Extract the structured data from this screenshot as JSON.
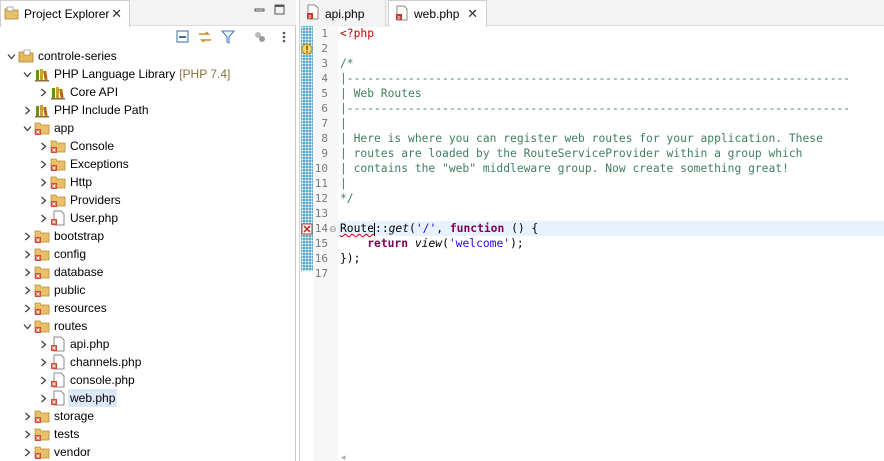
{
  "project_explorer": {
    "tab_title": "Project Explorer",
    "tree": [
      {
        "label": "controle-series",
        "level": 0,
        "expanded": true,
        "icon": "php-project-icon"
      },
      {
        "label": "PHP Language Library",
        "suffix": "[PHP 7.4]",
        "level": 1,
        "expanded": true,
        "icon": "library-icon"
      },
      {
        "label": "Core API",
        "level": 2,
        "expanded": false,
        "icon": "library-icon"
      },
      {
        "label": "PHP Include Path",
        "level": 1,
        "expanded": false,
        "icon": "library-icon"
      },
      {
        "label": "app",
        "level": 1,
        "expanded": true,
        "icon": "folder-icon"
      },
      {
        "label": "Console",
        "level": 2,
        "expanded": false,
        "icon": "folder-icon"
      },
      {
        "label": "Exceptions",
        "level": 2,
        "expanded": false,
        "icon": "folder-icon"
      },
      {
        "label": "Http",
        "level": 2,
        "expanded": false,
        "icon": "folder-icon"
      },
      {
        "label": "Providers",
        "level": 2,
        "expanded": false,
        "icon": "folder-icon"
      },
      {
        "label": "User.php",
        "level": 2,
        "expanded": false,
        "icon": "php-file-icon"
      },
      {
        "label": "bootstrap",
        "level": 1,
        "expanded": false,
        "icon": "folder-icon"
      },
      {
        "label": "config",
        "level": 1,
        "expanded": false,
        "icon": "folder-icon"
      },
      {
        "label": "database",
        "level": 1,
        "expanded": false,
        "icon": "folder-icon"
      },
      {
        "label": "public",
        "level": 1,
        "expanded": false,
        "icon": "folder-icon"
      },
      {
        "label": "resources",
        "level": 1,
        "expanded": false,
        "icon": "folder-icon"
      },
      {
        "label": "routes",
        "level": 1,
        "expanded": true,
        "icon": "folder-icon"
      },
      {
        "label": "api.php",
        "level": 2,
        "expanded": false,
        "icon": "php-file-icon"
      },
      {
        "label": "channels.php",
        "level": 2,
        "expanded": false,
        "icon": "php-file-icon"
      },
      {
        "label": "console.php",
        "level": 2,
        "expanded": false,
        "icon": "php-file-icon"
      },
      {
        "label": "web.php",
        "level": 2,
        "expanded": false,
        "icon": "php-file-icon",
        "selected": true
      },
      {
        "label": "storage",
        "level": 1,
        "expanded": false,
        "icon": "folder-icon"
      },
      {
        "label": "tests",
        "level": 1,
        "expanded": false,
        "icon": "folder-icon"
      },
      {
        "label": "vendor",
        "level": 1,
        "expanded": false,
        "icon": "folder-icon"
      }
    ]
  },
  "editor": {
    "tabs": [
      {
        "label": "api.php",
        "active": false
      },
      {
        "label": "web.php",
        "active": true
      }
    ],
    "line_numbers": [
      "1",
      "2",
      "3",
      "4",
      "5",
      "6",
      "7",
      "8",
      "9",
      "10",
      "11",
      "12",
      "13",
      "14",
      "15",
      "16",
      "17"
    ],
    "current_line": 14,
    "lines": {
      "l1": "<?php",
      "l3": "/*",
      "l4": "|--------------------------------------------------------------------------",
      "l5": "| Web Routes",
      "l6": "|--------------------------------------------------------------------------",
      "l7": "|",
      "l8": "| Here is where you can register web routes for your application. These",
      "l9": "| routes are loaded by the RouteServiceProvider within a group which",
      "l10": "| contains the \"web\" middleware group. Now create something great!",
      "l11": "|",
      "l12": "*/",
      "l14_class": "Route",
      "l14_sep": "::",
      "l14_method": "get",
      "l14_open": "(",
      "l14_arg": "'/'",
      "l14_comma": ", ",
      "l14_kw": "function",
      "l14_rest": " () {",
      "l15_indent": "    ",
      "l15_kw": "return",
      "l15_space": " ",
      "l15_fn": "view",
      "l15_open": "(",
      "l15_arg": "'welcome'",
      "l15_close": ");",
      "l16": "});"
    }
  },
  "colors": {
    "comment": "#3f7f5f",
    "php_tag": "#c00000",
    "keyword": "#7f0055",
    "string": "#2a00ff",
    "current_line_bg": "#e8f2fe",
    "selection_bg": "#dbe8f7"
  }
}
